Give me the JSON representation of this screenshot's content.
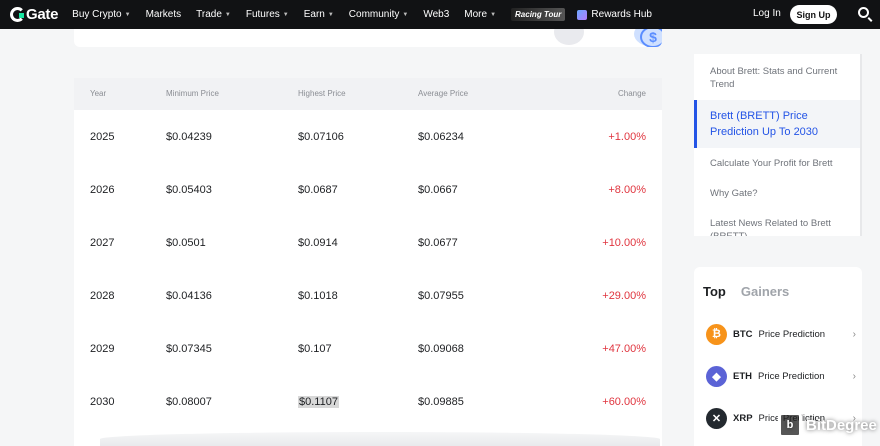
{
  "nav": {
    "logo": "Gate",
    "items": [
      {
        "label": "Buy Crypto",
        "caret": true
      },
      {
        "label": "Markets",
        "caret": false
      },
      {
        "label": "Trade",
        "caret": true
      },
      {
        "label": "Futures",
        "caret": true
      },
      {
        "label": "Earn",
        "caret": true
      },
      {
        "label": "Community",
        "caret": true
      },
      {
        "label": "Web3",
        "caret": false
      },
      {
        "label": "More",
        "caret": true
      }
    ],
    "racing": "Racing Tour",
    "rewards": "Rewards Hub",
    "login": "Log In",
    "signup": "Sign Up"
  },
  "table": {
    "headers": [
      "Year",
      "Minimum Price",
      "Highest Price",
      "Average Price",
      "Change"
    ],
    "rows": [
      [
        "2025",
        "$0.04239",
        "$0.07106",
        "$0.06234",
        "+1.00%"
      ],
      [
        "2026",
        "$0.05403",
        "$0.0687",
        "$0.0667",
        "+8.00%"
      ],
      [
        "2027",
        "$0.0501",
        "$0.0914",
        "$0.0677",
        "+10.00%"
      ],
      [
        "2028",
        "$0.04136",
        "$0.1018",
        "$0.07955",
        "+29.00%"
      ],
      [
        "2029",
        "$0.07345",
        "$0.107",
        "$0.09068",
        "+47.00%"
      ],
      [
        "2030",
        "$0.08007",
        "$0.1107",
        "$0.09885",
        "+60.00%"
      ]
    ]
  },
  "toc": {
    "items": [
      "About Brett: Stats and Current Trend",
      "Brett (BRETT) Price Prediction Up To 2030",
      "Calculate Your Profit for Brett",
      "Why Gate?",
      "Latest News Related to Brett (BRETT)"
    ]
  },
  "gainers": {
    "tab_top": "Top",
    "tab_gainers": "Gainers",
    "items": [
      {
        "symbol": "BTC",
        "label": "Price Prediction"
      },
      {
        "symbol": "ETH",
        "label": "Price Prediction"
      },
      {
        "symbol": "XRP",
        "label": "Price Prediction"
      }
    ]
  },
  "watermark": "BitDegree",
  "colors": {
    "accent": "#2354e6",
    "change": "#e0353f",
    "topbar": "#111214"
  }
}
